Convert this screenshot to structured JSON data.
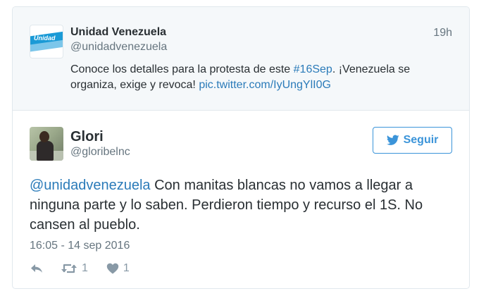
{
  "quoted_tweet": {
    "avatar_text": "Unidad",
    "name": "Unidad Venezuela",
    "handle": "@unidadvenezuela",
    "time": "19h",
    "text_before": "Conoce los detalles para la protesta de este ",
    "hashtag": "#16Sep",
    "text_middle": ". ¡Venezuela se organiza, exige y revoca! ",
    "link": "pic.twitter.com/IyUngYlI0G"
  },
  "tweet": {
    "name": "Glori",
    "handle": "@gloribelnc",
    "follow_label": "Seguir",
    "mention": "@unidadvenezuela",
    "text": " Con manitas blancas no vamos a llegar a ninguna parte y lo saben. Perdieron tiempo y recurso el 1S. No cansen al pueblo.",
    "timestamp": "16:05 - 14 sep 2016",
    "retweet_count": "1",
    "like_count": "1"
  },
  "colors": {
    "link": "#2b7bb9",
    "follow_border": "#3b94d9",
    "secondary_text": "#66757f",
    "icon_gray": "#8899a6"
  },
  "icons": [
    "twitter-bird-icon",
    "reply-icon",
    "retweet-icon",
    "heart-icon"
  ]
}
